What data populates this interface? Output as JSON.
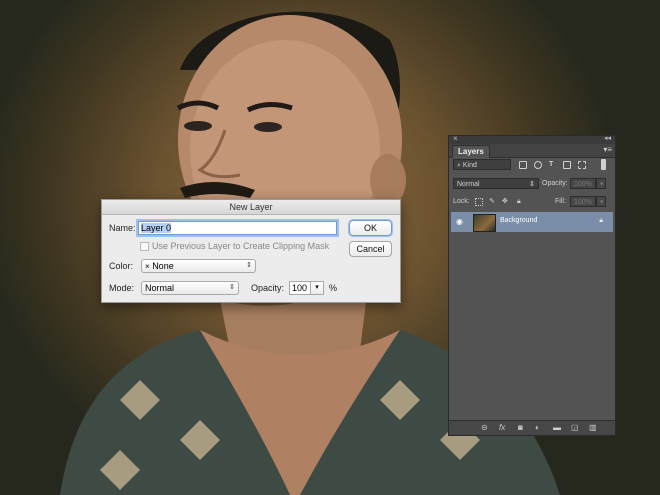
{
  "dialog": {
    "title": "New Layer",
    "name_label": "Name:",
    "name_value": "Layer 0",
    "clip_label": "Use Previous Layer to Create Clipping Mask",
    "color_label": "Color:",
    "color_value": "None",
    "color_swatch": "×",
    "mode_label": "Mode:",
    "mode_value": "Normal",
    "opacity_label": "Opacity:",
    "opacity_value": "100",
    "opacity_unit": "%",
    "ok_label": "OK",
    "cancel_label": "Cancel"
  },
  "layers_panel": {
    "tab_label": "Layers",
    "filter_value": "Kind",
    "blend_mode": "Normal",
    "opacity_label": "Opacity:",
    "opacity_value": "100%",
    "lock_label": "Lock:",
    "fill_label": "Fill:",
    "fill_value": "100%",
    "layers": [
      {
        "name": "Background",
        "visible": true,
        "locked": true
      }
    ],
    "footer_icons": [
      "link-icon",
      "fx-icon",
      "mask-icon",
      "adjustment-icon",
      "folder-icon",
      "new-layer-icon",
      "trash-icon"
    ]
  },
  "colors": {
    "panel_bg": "#535353",
    "selected_layer": "#7a8ea8",
    "dialog_bg": "#ececec",
    "focus_ring": "#9dc0ee"
  }
}
